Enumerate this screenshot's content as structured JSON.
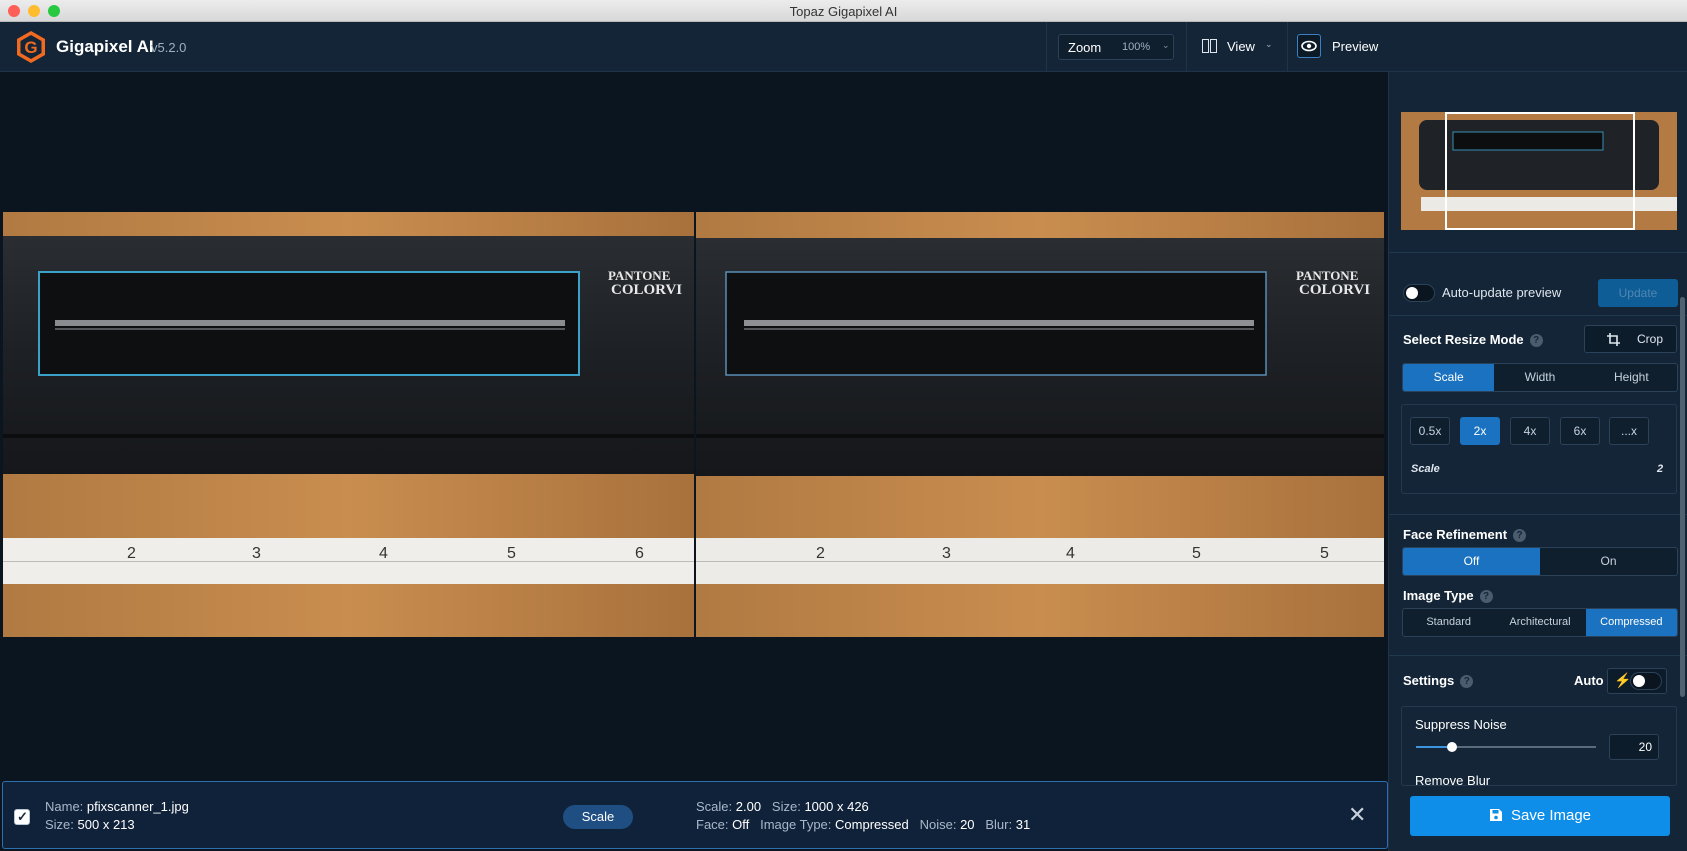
{
  "window": {
    "title": "Topaz Gigapixel AI"
  },
  "app": {
    "name": "Gigapixel AI",
    "version": "v5.2.0"
  },
  "toolbar": {
    "zoom_label": "Zoom",
    "zoom_value": "100%",
    "view_label": "View",
    "preview_label": "Preview"
  },
  "image": {
    "brand_text_1": "PANTONE",
    "brand_text_2": "COLORVI",
    "ruler_numbers": [
      "2",
      "3",
      "4",
      "5",
      "6"
    ],
    "ruler_numbers_right": [
      "2",
      "3",
      "4",
      "5",
      "5"
    ]
  },
  "file": {
    "name_key": "Name:",
    "name": "pfixscanner_1.jpg",
    "size_key": "Size:",
    "size": "500 x 213",
    "mode": "Scale",
    "scale_key": "Scale:",
    "scale": "2.00",
    "out_size_key": "Size:",
    "out_size": "1000 x 426",
    "face_key": "Face:",
    "face": "Off",
    "type_key": "Image Type:",
    "type": "Compressed",
    "noise_key": "Noise:",
    "noise": "20",
    "blur_key": "Blur:",
    "blur": "31"
  },
  "panel": {
    "auto_update_label": "Auto-update preview",
    "auto_update_on": false,
    "update_label": "Update",
    "resize_mode_label": "Select Resize Mode",
    "crop_label": "Crop",
    "resize_tabs": [
      {
        "label": "Scale",
        "active": true
      },
      {
        "label": "Width",
        "active": false
      },
      {
        "label": "Height",
        "active": false
      }
    ],
    "scale_chips": [
      {
        "label": "0.5x",
        "active": false
      },
      {
        "label": "2x",
        "active": true
      },
      {
        "label": "4x",
        "active": false
      },
      {
        "label": "6x",
        "active": false
      },
      {
        "label": "...x",
        "active": false
      }
    ],
    "scale_row_label": "Scale",
    "scale_row_value": "2",
    "face_label": "Face Refinement",
    "face_options": [
      {
        "label": "Off",
        "active": true
      },
      {
        "label": "On",
        "active": false
      }
    ],
    "image_type_label": "Image Type",
    "image_type_options": [
      {
        "label": "Standard",
        "active": false
      },
      {
        "label": "Architectural",
        "active": false
      },
      {
        "label": "Compressed",
        "active": true
      }
    ],
    "settings_label": "Settings",
    "auto_label": "Auto",
    "auto_on": false,
    "suppress_noise_label": "Suppress Noise",
    "suppress_noise_value": "20",
    "suppress_noise_level": 0.2,
    "remove_blur_label": "Remove Blur",
    "save_label": "Save Image"
  },
  "colors": {
    "accent": "#1b72c0",
    "save": "#0e8ee8",
    "logo": "#f26a21"
  }
}
